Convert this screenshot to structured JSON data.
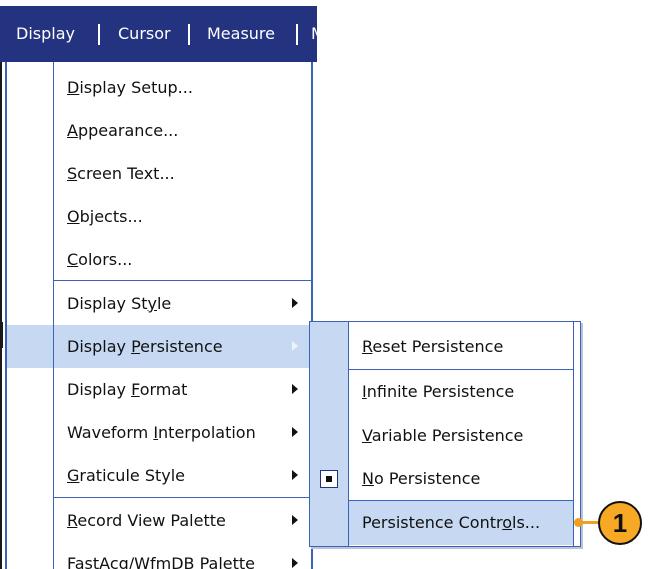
{
  "menubar": {
    "items": [
      {
        "label": "Display"
      },
      {
        "label": "Cursor"
      },
      {
        "label": "Measure"
      },
      {
        "label": "M"
      }
    ]
  },
  "display_menu": {
    "items": [
      {
        "pre": "",
        "key": "D",
        "post": "isplay Setup..."
      },
      {
        "pre": "",
        "key": "A",
        "post": "ppearance..."
      },
      {
        "pre": "",
        "key": "S",
        "post": "creen Text..."
      },
      {
        "pre": "",
        "key": "O",
        "post": "bjects..."
      },
      {
        "pre": "",
        "key": "C",
        "post": "olors..."
      },
      {
        "pre": "Display St",
        "key": "y",
        "post": "le",
        "submenu": true
      },
      {
        "pre": "Display ",
        "key": "P",
        "post": "ersistence",
        "submenu": true,
        "highlighted": true
      },
      {
        "pre": "Display ",
        "key": "F",
        "post": "ormat",
        "submenu": true
      },
      {
        "pre": "Waveform ",
        "key": "I",
        "post": "nterpolation",
        "submenu": true
      },
      {
        "pre": "",
        "key": "G",
        "post": "raticule Style",
        "submenu": true
      },
      {
        "pre": "",
        "key": "R",
        "post": "ecord View Palette",
        "submenu": true
      },
      {
        "pre": "",
        "key": "",
        "post": "FastAcq/WfmDB Palette",
        "submenu": true
      }
    ]
  },
  "persistence_submenu": {
    "items": [
      {
        "pre": "",
        "key": "R",
        "post": "eset Persistence"
      },
      {
        "pre": "",
        "key": "I",
        "post": "nfinite Persistence"
      },
      {
        "pre": "",
        "key": "V",
        "post": "ariable Persistence"
      },
      {
        "pre": "",
        "key": "N",
        "post": "o Persistence",
        "selected": true
      },
      {
        "pre": "Persistence Contr",
        "key": "o",
        "post": "ls...",
        "highlighted": true
      }
    ]
  },
  "callout": {
    "number": "1",
    "color": "#f7a824"
  },
  "colors": {
    "menubar": "#23337f",
    "highlight": "#c7d9f2",
    "border": "#3b62b6"
  }
}
